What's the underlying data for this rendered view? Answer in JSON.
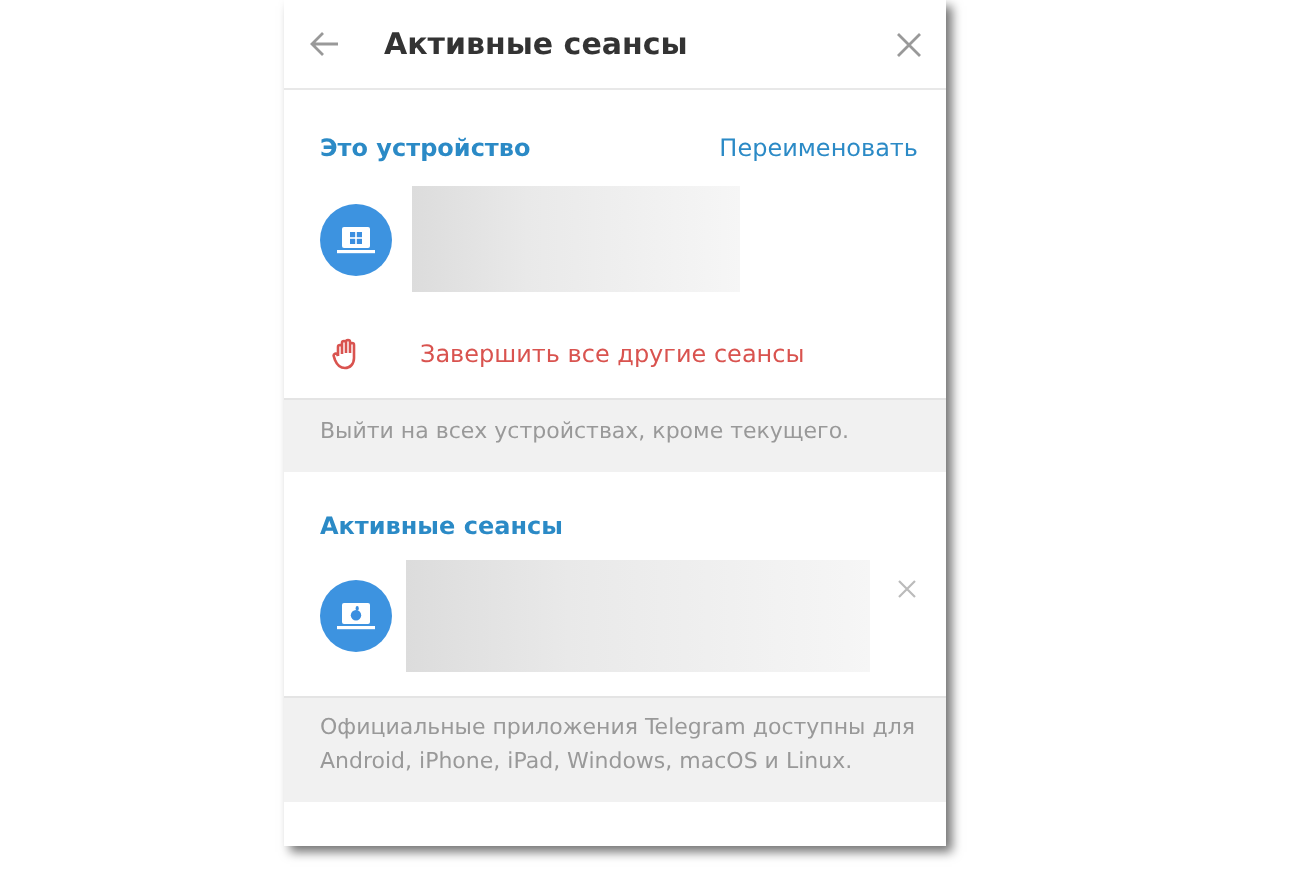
{
  "window": {
    "title": "Активные сеансы"
  },
  "this_device": {
    "title": "Это устройство",
    "rename_link": "Переименовать",
    "device": {
      "kind": "windows"
    },
    "terminate_all": "Завершить все другие сеансы",
    "note": "Выйти на всех устройствах, кроме текущего."
  },
  "active_sessions": {
    "title": "Активные сеансы",
    "sessions": [
      {
        "kind": "apple"
      }
    ],
    "note": "Официальные приложения Telegram доступны для Android, iPhone, iPad, Windows, macOS и Linux."
  }
}
